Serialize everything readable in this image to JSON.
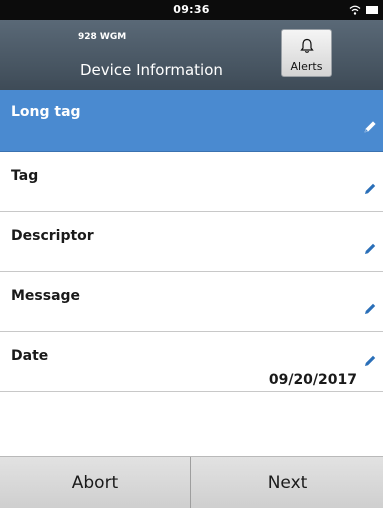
{
  "status_bar": {
    "time": "09:36"
  },
  "header": {
    "device_name": "928 WGM",
    "title": "Device Information",
    "alerts_label": "Alerts"
  },
  "rows": [
    {
      "label": "Long tag",
      "value": "",
      "selected": true,
      "icon": "pencil-icon"
    },
    {
      "label": "Tag",
      "value": "",
      "icon": "pencil-icon"
    },
    {
      "label": "Descriptor",
      "value": "",
      "icon": "pencil-icon"
    },
    {
      "label": "Message",
      "value": "",
      "icon": "pencil-icon"
    },
    {
      "label": "Date",
      "value": "09/20/2017",
      "icon": "pencil-icon"
    }
  ],
  "footer": {
    "abort_label": "Abort",
    "next_label": "Next"
  },
  "colors": {
    "header": "#4b5864",
    "selected_row": "#4a8ad0",
    "pencil": "#2a6fb8"
  }
}
